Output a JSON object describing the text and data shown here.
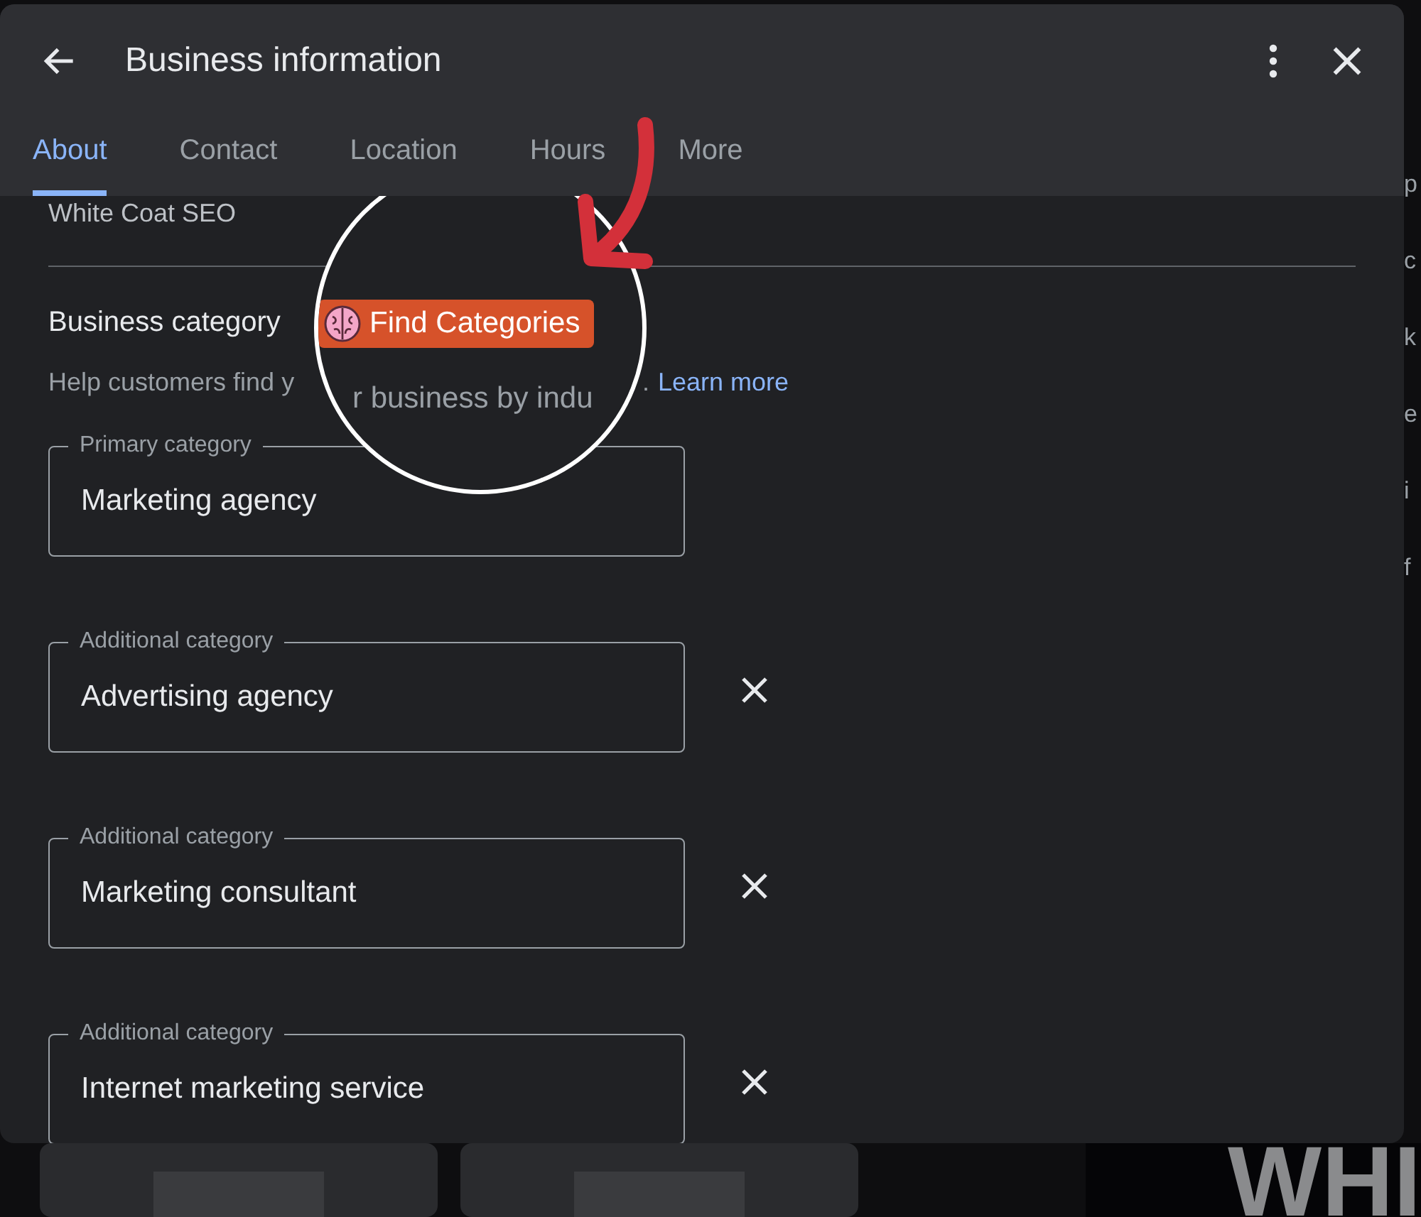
{
  "dialog": {
    "title": "Business information",
    "tabs": [
      {
        "label": "About",
        "selected": true
      },
      {
        "label": "Contact",
        "selected": false
      },
      {
        "label": "Location",
        "selected": false
      },
      {
        "label": "Hours",
        "selected": false
      },
      {
        "label": "More",
        "selected": false
      }
    ],
    "business_name": "White Coat SEO",
    "section_title": "Business category",
    "find_button": "Find Categories",
    "help_text": "Help customers find y",
    "magnified_text": "r business by indu",
    "help_text_end": ".",
    "learn_more": "Learn more",
    "fields": [
      {
        "label": "Primary category",
        "value": "Marketing agency",
        "removable": false
      },
      {
        "label": "Additional category",
        "value": "Advertising agency",
        "removable": true
      },
      {
        "label": "Additional category",
        "value": "Marketing consultant",
        "removable": true
      },
      {
        "label": "Additional category",
        "value": "Internet marketing service",
        "removable": true
      }
    ]
  },
  "background": {
    "edge_fragments": [
      "p",
      "c",
      "k",
      "e",
      "i",
      "f"
    ],
    "banner": "WHI"
  }
}
